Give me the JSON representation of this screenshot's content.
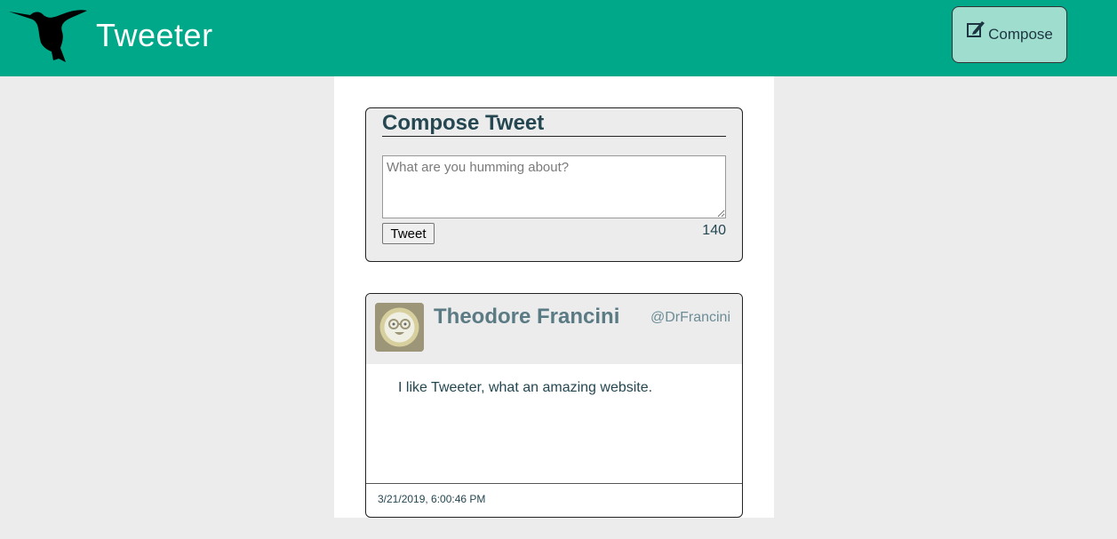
{
  "nav": {
    "brand": "Tweeter",
    "logo_icon": "hummingbird-icon",
    "compose_button_label": "Compose",
    "compose_button_icon": "pencil-square-icon",
    "background_color": "#00a88a"
  },
  "compose": {
    "heading": "Compose Tweet",
    "placeholder": "What are you humming about?",
    "value": "",
    "submit_label": "Tweet",
    "char_counter": "140"
  },
  "tweets": [
    {
      "author_name": "Theodore Francini",
      "handle": "@DrFrancini",
      "avatar_icon": "smiley-glasses-avatar-icon",
      "content": "I like Tweeter, what an amazing website.",
      "timestamp": "3/21/2019, 6:00:46 PM"
    }
  ]
}
